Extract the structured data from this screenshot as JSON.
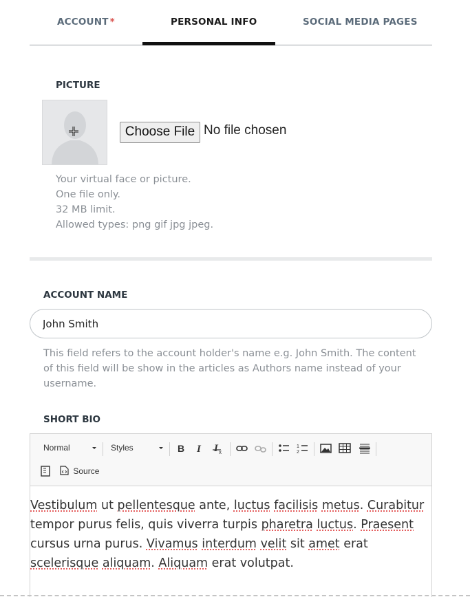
{
  "tabs": {
    "account": "ACCOUNT",
    "account_required": "*",
    "personal": "PERSONAL INFO",
    "social": "SOCIAL MEDIA PAGES"
  },
  "picture": {
    "label": "PICTURE",
    "choose_file": "Choose File",
    "file_status": "No file chosen",
    "help": [
      "Your virtual face or picture.",
      "One file only.",
      "32 MB limit.",
      "Allowed types: png gif jpg jpeg."
    ]
  },
  "account_name": {
    "label": "ACCOUNT NAME",
    "value": "John Smith",
    "help": "This field refers to the account holder's name e.g. John Smith. The content of this field will be show in the articles as Authors name instead of your username."
  },
  "short_bio": {
    "label": "SHORT BIO",
    "toolbar": {
      "format": "Normal",
      "styles": "Styles",
      "source": "Source",
      "icons": [
        "bold-icon",
        "italic-icon",
        "remove-format-icon",
        "link-icon",
        "unlink-icon",
        "bulleted-list-icon",
        "numbered-list-icon",
        "image-icon",
        "table-icon",
        "horizontal-line-icon",
        "maximize-icon",
        "source-icon"
      ]
    },
    "lines": [
      "Vestibulum ut pellentesque ante, luctus facilisis metus. Curabitur",
      "tempor purus felis, quis viverra turpis pharetra luctus. Praesent",
      "cursus urna purus. Vivamus interdum velit sit amet erat",
      "scelerisque aliquam. Aliquam erat volutpat."
    ]
  },
  "colors": {
    "active_tab_underline": "#111111",
    "required_star": "#d9534f",
    "help_text": "#8a8f95",
    "spellcheck_underline": "#e04848"
  }
}
